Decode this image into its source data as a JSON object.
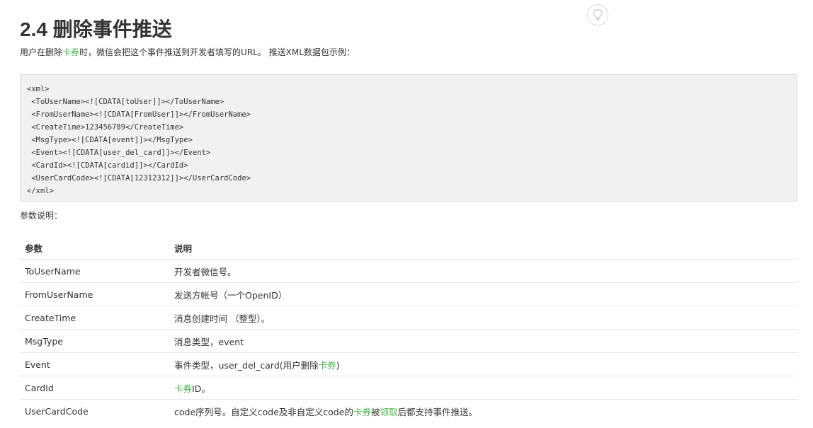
{
  "section_title": "2.4 删除事件推送",
  "intro": {
    "before": "用户在删除",
    "link": "卡券",
    "after": "时，微信会把这个事件推送到开发者填写的URL。 推送XML数据包示例："
  },
  "code_sample": "<xml>\n <ToUserName><![CDATA[toUser]]></ToUserName>\n <FromUserName><![CDATA[FromUser]]></FromUserName>\n <CreateTime>123456789</CreateTime>\n <MsgType><![CDATA[event]]></MsgType>\n <Event><![CDATA[user_del_card]]></Event>\n <CardId><![CDATA[cardid]]></CardId>\n <UserCardCode><![CDATA[12312312]]></UserCardCode>\n</xml>",
  "params_label": "参数说明：",
  "table": {
    "headers": [
      "参数",
      "说明"
    ],
    "rows": [
      {
        "name": "ToUserName",
        "desc": [
          {
            "text": "开发者微信号。"
          }
        ]
      },
      {
        "name": "FromUserName",
        "desc": [
          {
            "text": "发送方帐号（一个OpenID）"
          }
        ]
      },
      {
        "name": "CreateTime",
        "desc": [
          {
            "text": "消息创建时间 （整型）。"
          }
        ]
      },
      {
        "name": "MsgType",
        "desc": [
          {
            "text": "消息类型，event"
          }
        ]
      },
      {
        "name": "Event",
        "desc": [
          {
            "text": "事件类型，user_del_card(用户删除"
          },
          {
            "text": "卡券",
            "link": true
          },
          {
            "text": ")"
          }
        ]
      },
      {
        "name": "CardId",
        "desc": [
          {
            "text": "卡券",
            "link": true
          },
          {
            "text": "ID。"
          }
        ]
      },
      {
        "name": "UserCardCode",
        "desc": [
          {
            "text": "code序列号。自定义code及非自定义code的"
          },
          {
            "text": "卡券",
            "link": true
          },
          {
            "text": "被"
          },
          {
            "text": "领取",
            "link": true
          },
          {
            "text": "后都支持事件推送。"
          }
        ]
      }
    ]
  },
  "icons": {
    "help": "lightbulb-icon"
  },
  "colors": {
    "link": "#44b549",
    "text": "#333333",
    "code_bg": "#f1f1f1"
  }
}
